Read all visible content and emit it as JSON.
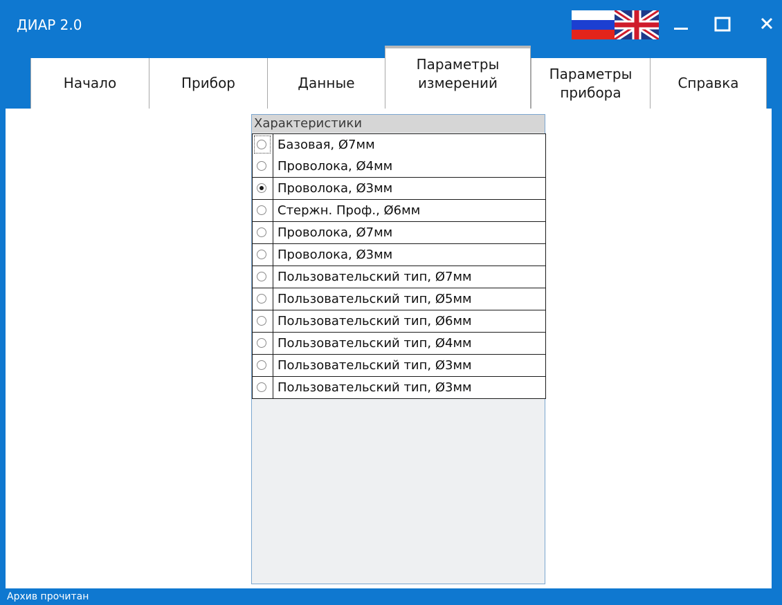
{
  "window": {
    "title": "ДИАР 2.0",
    "accent_color": "#0f78d0"
  },
  "title_controls": {
    "language_ru": "flag-russia-icon",
    "language_en": "flag-uk-icon",
    "minimize": "minimize-icon",
    "maximize": "maximize-icon",
    "close": "close-icon"
  },
  "tabs": [
    {
      "label": "Начало",
      "active": false
    },
    {
      "label": "Прибор",
      "active": false
    },
    {
      "label": "Данные",
      "active": false
    },
    {
      "label": "Параметры\nизмерений",
      "active": true
    },
    {
      "label": "Параметры\nприбора",
      "active": false
    },
    {
      "label": "Справка",
      "active": false
    }
  ],
  "characteristics": {
    "header": "Характеристики",
    "selected_index": 2,
    "items": [
      {
        "label": "Базовая, Ø7мм"
      },
      {
        "label": "Проволока, Ø4мм"
      },
      {
        "label": "Проволока, Ø3мм"
      },
      {
        "label": "Стержн. Проф., Ø6мм"
      },
      {
        "label": "Проволока, Ø7мм"
      },
      {
        "label": "Проволока, Ø3мм"
      },
      {
        "label": "Пользовательский тип, Ø7мм"
      },
      {
        "label": "Пользовательский тип, Ø5мм"
      },
      {
        "label": "Пользовательский тип, Ø6мм"
      },
      {
        "label": "Пользовательский тип, Ø4мм"
      },
      {
        "label": "Пользовательский тип, Ø3мм"
      },
      {
        "label": "Пользовательский тип, Ø3мм"
      }
    ]
  },
  "status": {
    "text": "Архив прочитан"
  }
}
